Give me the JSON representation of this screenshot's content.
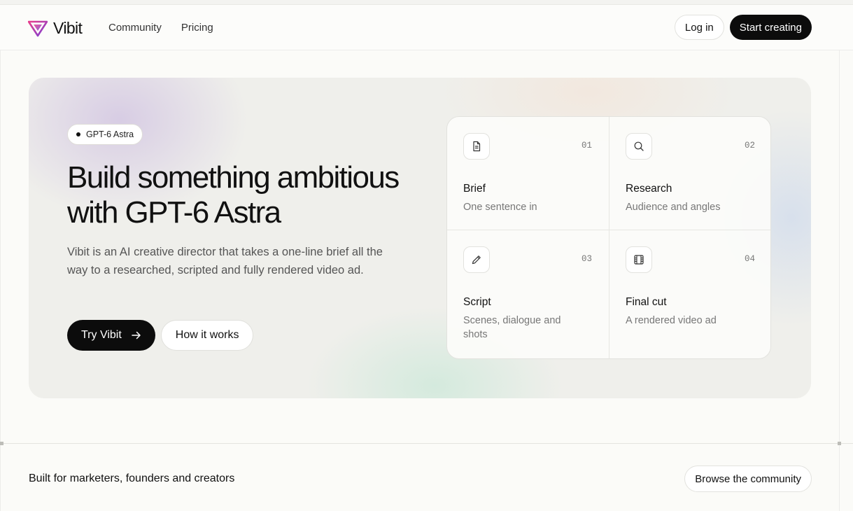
{
  "header": {
    "brand": "Vibit",
    "nav": [
      "Community",
      "Pricing"
    ],
    "login_label": "Log in",
    "start_label": "Start creating"
  },
  "hero": {
    "badge": "GPT-6 Astra",
    "title_line1": "Build something ambitious",
    "title_line2": "with GPT-6 Astra",
    "description": "Vibit is an AI creative director that takes a one-line brief all the way to a researched, scripted and fully rendered video ad.",
    "try_label": "Try Vibit",
    "how_label": "How it works"
  },
  "steps": [
    {
      "num": "01",
      "title": "Brief",
      "subtitle": "One sentence in",
      "icon": "document-icon"
    },
    {
      "num": "02",
      "title": "Research",
      "subtitle": "Audience and angles",
      "icon": "search-icon"
    },
    {
      "num": "03",
      "title": "Script",
      "subtitle": "Scenes, dialogue and shots",
      "icon": "pen-icon"
    },
    {
      "num": "04",
      "title": "Final cut",
      "subtitle": "A rendered video ad",
      "icon": "film-icon"
    }
  ],
  "footer": {
    "tagline": "Built for marketers, founders and creators",
    "browse_label": "Browse the community"
  },
  "colors": {
    "primary": "#0c0c0c",
    "logo_pink": "#d6287f",
    "logo_purple": "#7a3fd6"
  }
}
